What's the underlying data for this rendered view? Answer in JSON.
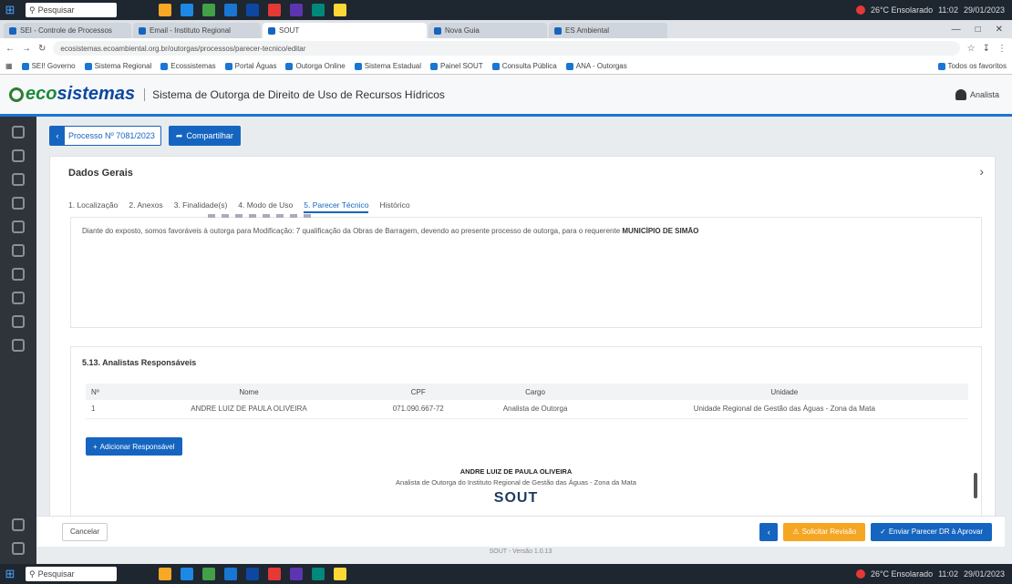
{
  "taskbar": {
    "search_placeholder": "Pesquisar",
    "tray_text": "26°C Ensolarado",
    "time": "11:02",
    "date": "29/01/2023"
  },
  "browser": {
    "tabs": [
      {
        "label": "SEI - Controle de Processos"
      },
      {
        "label": "Email - Instituto Regional"
      },
      {
        "label": "SOUT"
      },
      {
        "label": "Nova Guia"
      },
      {
        "label": "ES Ambiental"
      }
    ],
    "url": "ecosistemas.ecoambiental.org.br/outorgas/processos/parecer-tecnico/editar",
    "bookmarks": [
      "SEI! Governo",
      "Sistema Regional",
      "Ecossistemas",
      "Portal Águas",
      "Outorga Online",
      "Sistema Estadual",
      "Painel SOUT",
      "Consulta Pública",
      "ANA - Outorgas",
      "Todos os favoritos"
    ]
  },
  "header": {
    "logo_eco": "eco",
    "logo_sis": "sistemas",
    "system_title": "Sistema de Outorga de Direito de Uso de Recursos Hídricos",
    "user_label": "Analista"
  },
  "process": {
    "label": "Processo Nº 7081/2023",
    "share_button": "Compartilhar"
  },
  "card": {
    "title": "Dados Gerais",
    "steps": [
      "1. Localização",
      "2. Anexos",
      "3. Finalidade(s)",
      "4. Modo de Uso",
      "5. Parecer Técnico",
      "Histórico"
    ],
    "active_step": 4,
    "editor_text_prefix": "Diante do exposto, somos favoráveis à outorga para Modificação: 7 qualificação da Obras de Barragem, devendo ao presente processo de outorga, para o requerente",
    "editor_text_bold": "MUNICÍPIO DE SIMÃO"
  },
  "analysts": {
    "title": "5.13. Analistas Responsáveis",
    "columns": [
      "Nº",
      "Nome",
      "CPF",
      "Cargo",
      "Unidade"
    ],
    "rows": [
      {
        "n": "1",
        "nome": "ANDRE LUIZ DE PAULA OLIVEIRA",
        "cpf": "071.090.667-72",
        "cargo": "Analista de Outorga",
        "unidade": "Unidade Regional de Gestão das Águas - Zona da Mata"
      }
    ],
    "add_button": "Adicionar Responsável",
    "signature_name": "ANDRE LUIZ DE PAULA OLIVEIRA",
    "signature_role": "Analista de Outorga do Instituto Regional de Gestão das Águas - Zona da Mata",
    "signature_logo": "SOUT"
  },
  "footer": {
    "cancel": "Cancelar",
    "warning_button": "Solicitar Revisão",
    "submit_button": "Enviar Parecer DR à Aprovar",
    "version": "SOUT - Versão 1.0.13"
  },
  "colors": {
    "primary": "#1565c0",
    "warning": "#f5a623",
    "logo_green": "#1b8a3a",
    "sidebar": "#2f343a"
  }
}
